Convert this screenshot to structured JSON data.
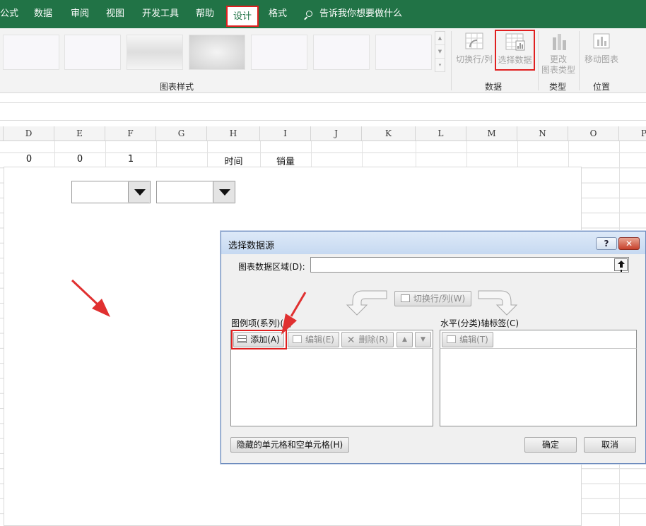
{
  "tabs": [
    {
      "label": "公式"
    },
    {
      "label": "数据"
    },
    {
      "label": "审阅"
    },
    {
      "label": "视图"
    },
    {
      "label": "开发工具"
    },
    {
      "label": "帮助"
    },
    {
      "label": "设计"
    },
    {
      "label": "格式"
    }
  ],
  "search": {
    "text": "告诉我你想要做什么",
    "icon": "search-icon"
  },
  "ribbon": {
    "chart_styles_label": "图表样式",
    "data_group_label": "数据",
    "type_group_label": "类型",
    "location_group_label": "位置",
    "switch_row_col_label": "切换行/列",
    "select_data_label": "选择数据",
    "change_chart_type_label_1": "更改",
    "change_chart_type_label_2": "图表类型",
    "move_chart_label": "移动图表"
  },
  "columns": [
    "D",
    "E",
    "F",
    "G",
    "H",
    "I",
    "J",
    "K",
    "L",
    "M",
    "N",
    "O",
    "P"
  ],
  "cells": {
    "d": "0",
    "e": "0",
    "f": "1",
    "h": "时间",
    "i": "销量"
  },
  "dialog": {
    "title": "选择数据源",
    "help_label": "?",
    "close_label": "✕",
    "range_label": "图表数据区域(D):",
    "switch_label": "切换行/列(W)",
    "legend_label": "图例项(系列)(S)",
    "add_label": "添加(A)",
    "edit_label": "编辑(E)",
    "delete_label": "删除(R)",
    "axis_label": "水平(分类)轴标签(C)",
    "axis_edit_label": "编辑(T)",
    "hidden_cells_label": "隐藏的单元格和空单元格(H)",
    "ok_label": "确定",
    "cancel_label": "取消"
  },
  "colors": {
    "ribbon_green": "#217346",
    "highlight_red": "#e02020"
  }
}
